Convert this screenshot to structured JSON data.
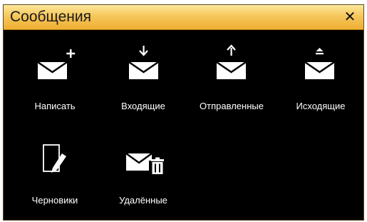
{
  "window": {
    "title": "Сообщения",
    "close_label": "✕"
  },
  "items": [
    {
      "label": "Написать",
      "icon": "compose-icon"
    },
    {
      "label": "Входящие",
      "icon": "inbox-icon"
    },
    {
      "label": "Отправленные",
      "icon": "sent-icon"
    },
    {
      "label": "Исходящие",
      "icon": "outbox-icon"
    },
    {
      "label": "Черновики",
      "icon": "drafts-icon"
    },
    {
      "label": "Удалённые",
      "icon": "trash-icon"
    }
  ],
  "colors": {
    "titlebar_top": "#fde79a",
    "titlebar_bottom": "#eeae31",
    "background": "#000000",
    "text": "#ffffff"
  }
}
